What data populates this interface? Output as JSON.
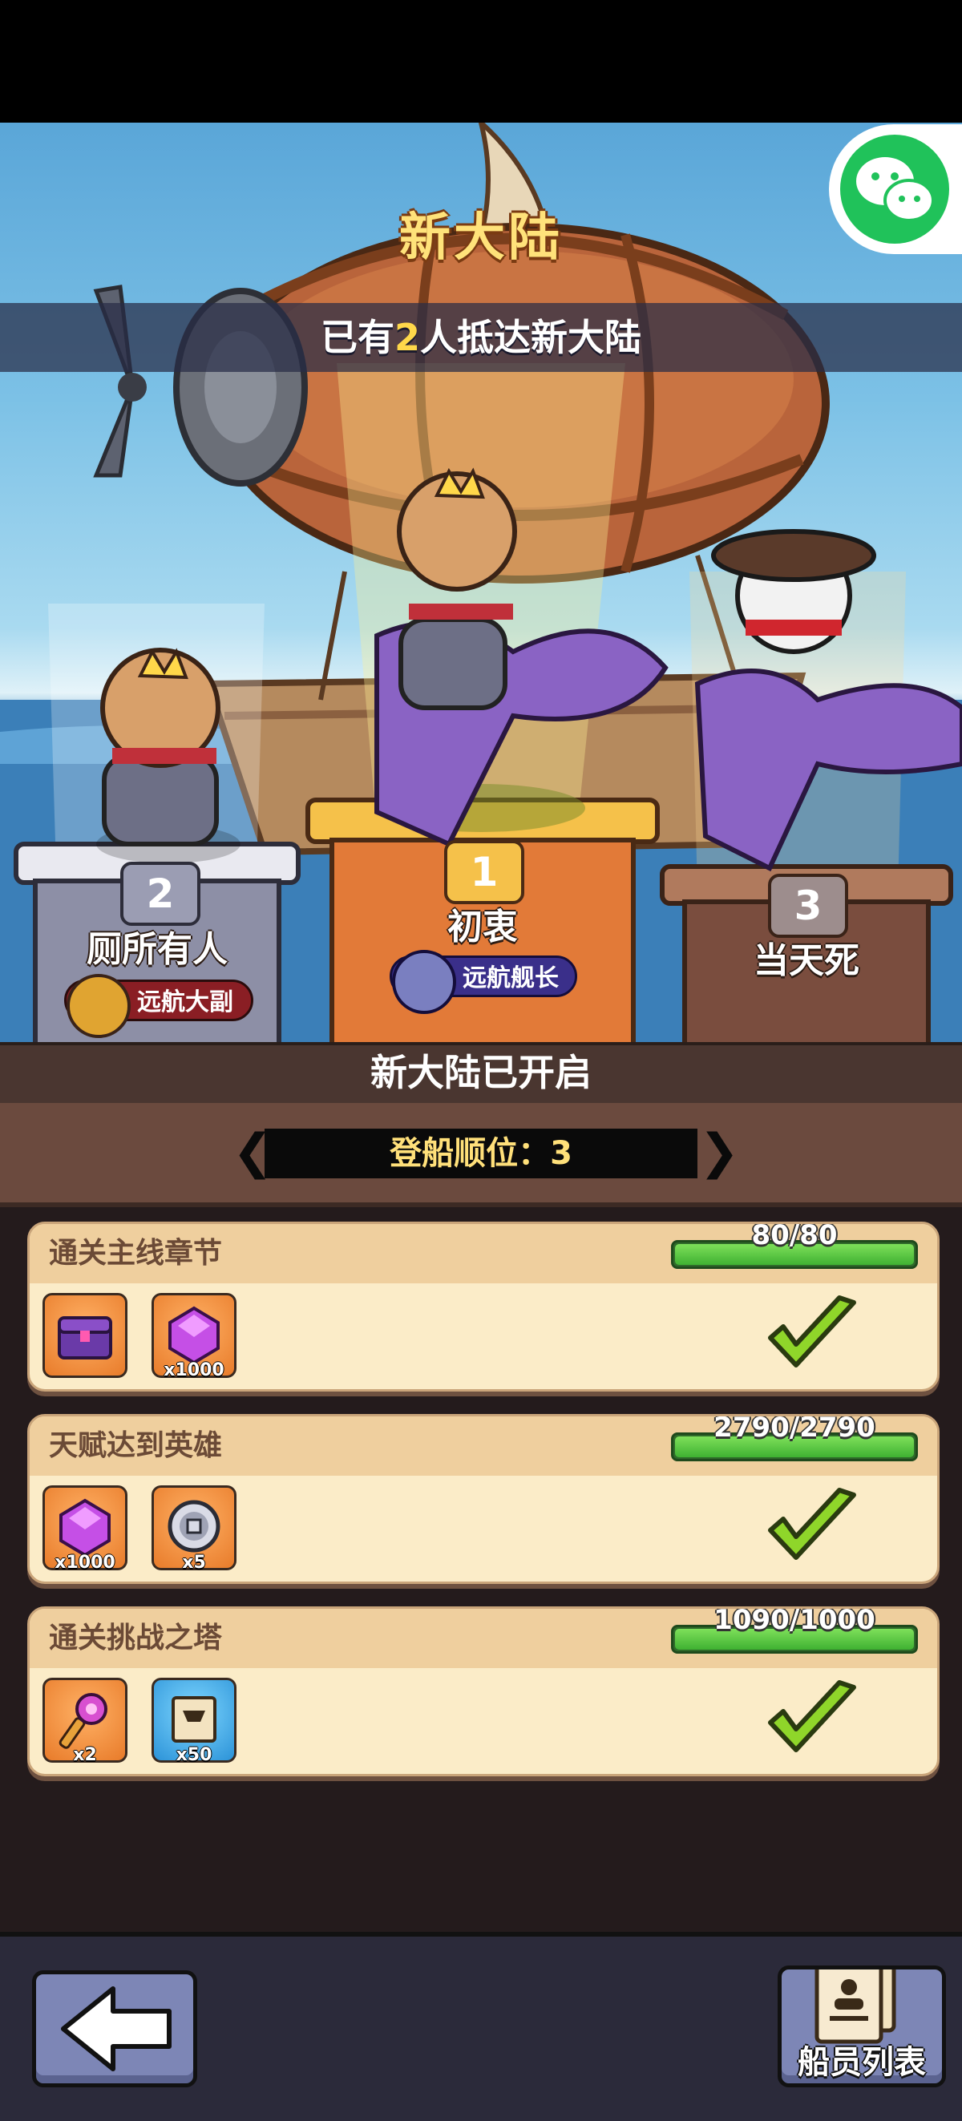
{
  "header": {
    "title": "新大陆",
    "arrived_prefix": "已有",
    "arrived_count": "2",
    "arrived_suffix": "人抵达新大陆"
  },
  "share": {
    "icon": "wechat-icon",
    "color": "#20c25a"
  },
  "podium": [
    {
      "rank": "2",
      "name": "厕所有人",
      "title": "远航大副",
      "title_color": "#8a1e24"
    },
    {
      "rank": "1",
      "name": "初衷",
      "title": "远航舰长",
      "title_color": "#3a2f8a"
    },
    {
      "rank": "3",
      "name": "当天死",
      "title": "",
      "title_color": ""
    }
  ],
  "status": {
    "text": "新大陆已开启"
  },
  "boarding": {
    "label": "登船顺位：3"
  },
  "tasks": [
    {
      "title": "通关主线章节",
      "progress_text": "80/80",
      "progress": 1.0,
      "rewards": [
        {
          "icon": "treasure-chest-icon",
          "qty": "",
          "frame": "orange"
        },
        {
          "icon": "purple-gem-icon",
          "qty": "x1000",
          "frame": "orange"
        }
      ],
      "completed": true
    },
    {
      "title": "天赋达到英雄",
      "progress_text": "2790/2790",
      "progress": 1.0,
      "rewards": [
        {
          "icon": "purple-gem-icon",
          "qty": "x1000",
          "frame": "orange"
        },
        {
          "icon": "silver-coin-icon",
          "qty": "x5",
          "frame": "orange"
        }
      ],
      "completed": true
    },
    {
      "title": "通关挑战之塔",
      "progress_text": "1090/1000",
      "progress": 1.0,
      "rewards": [
        {
          "icon": "magic-key-icon",
          "qty": "x2",
          "frame": "orange"
        },
        {
          "icon": "scroll-icon",
          "qty": "x50",
          "frame": "blue"
        }
      ],
      "completed": true
    }
  ],
  "footer": {
    "back_icon": "back-arrow-icon",
    "crew_icon": "crew-list-icon",
    "crew_label": "船员列表"
  }
}
